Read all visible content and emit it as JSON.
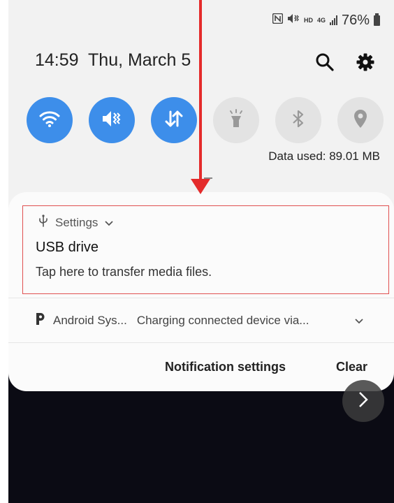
{
  "status_bar": {
    "icons": [
      "nfc-icon",
      "vibrate-icon",
      "hd-icon",
      "4g-icon",
      "signal-icon",
      "battery-icon"
    ],
    "hd_label": "HD",
    "network_label": "4G",
    "battery": "76%"
  },
  "header": {
    "time": "14:59",
    "date": "Thu, March 5",
    "search_icon": "search-icon",
    "settings_icon": "gear-icon"
  },
  "quick_settings": [
    {
      "name": "wifi",
      "icon": "wifi-icon",
      "active": true
    },
    {
      "name": "sound",
      "icon": "vibrate-icon",
      "active": true
    },
    {
      "name": "mobile-data",
      "icon": "data-arrows-icon",
      "active": true
    },
    {
      "name": "flashlight",
      "icon": "flashlight-icon",
      "active": false
    },
    {
      "name": "bluetooth",
      "icon": "bluetooth-icon",
      "active": false
    },
    {
      "name": "location",
      "icon": "location-icon",
      "active": false
    }
  ],
  "data_used": "Data used: 89.01 MB",
  "notifications": {
    "usb": {
      "app": "Settings",
      "title": "USB drive",
      "text": "Tap here to transfer media files."
    },
    "android": {
      "app": "Android Sys...",
      "text": "Charging connected device via..."
    },
    "notification_settings_label": "Notification settings",
    "clear_label": "Clear"
  },
  "colors": {
    "accent": "#3d8eea",
    "annotation": "#e42b2b"
  }
}
